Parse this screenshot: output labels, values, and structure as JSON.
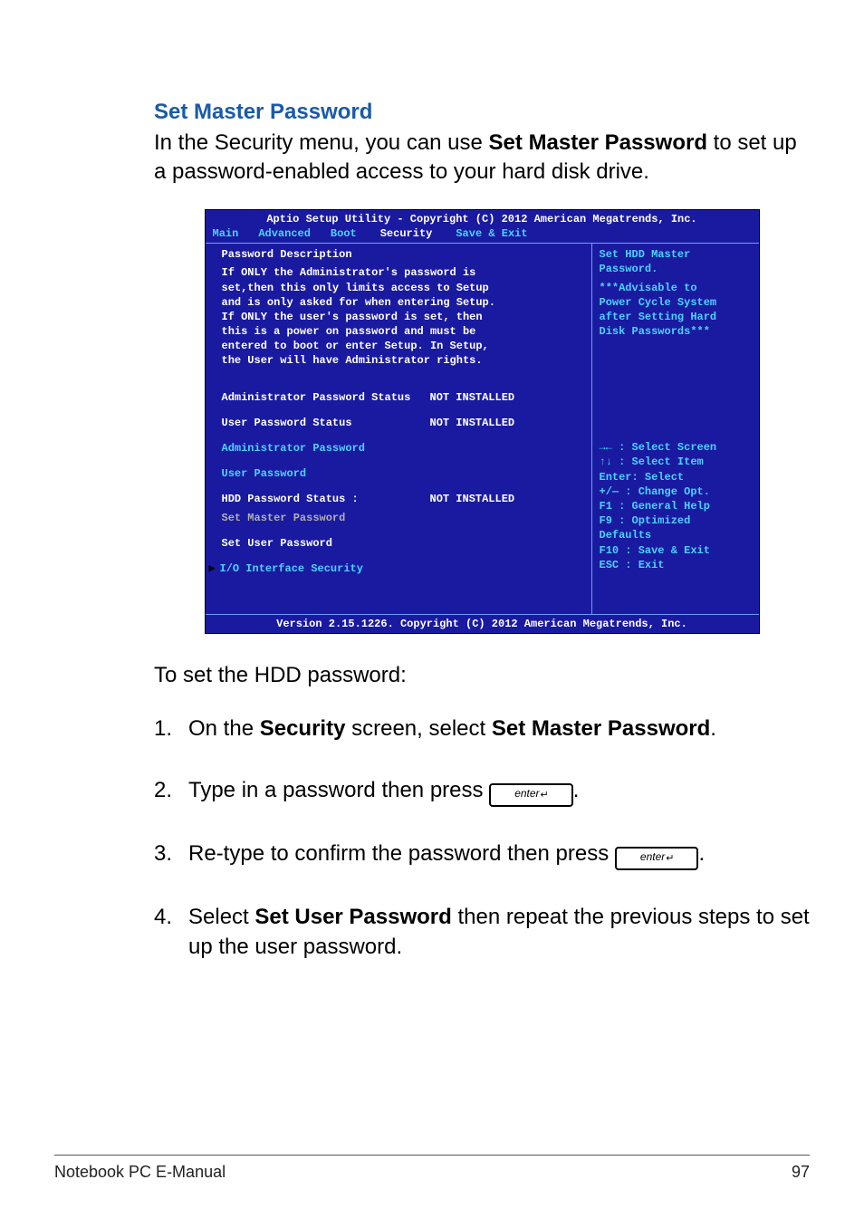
{
  "heading": "Set Master Password",
  "intro_before": "In the Security menu, you can use ",
  "intro_bold": "Set Master Password",
  "intro_after": " to set up a password-enabled access to your hard disk drive.",
  "bios": {
    "title": "Aptio Setup Utility - Copyright (C) 2012 American Megatrends, Inc.",
    "tabs": {
      "main": "Main",
      "advanced": "Advanced",
      "boot": "Boot",
      "security": "Security",
      "save_exit": "Save & Exit"
    },
    "left": {
      "pd_head": "Password Description",
      "desc1": "If ONLY the Administrator's password is",
      "desc2": "set,then this only limits access to Setup",
      "desc3": "and is only asked for when entering Setup.",
      "desc4": "If ONLY the user's password is set, then",
      "desc5": "this is a power on password and must be",
      "desc6": "entered to boot or enter Setup. In Setup,",
      "desc7": "the User will have Administrator rights.",
      "admin_status_lbl": "Administrator Password Status",
      "admin_status_val": "NOT INSTALLED",
      "user_status_lbl": "User Password Status",
      "user_status_val": "NOT INSTALLED",
      "admin_pw": "Administrator Password",
      "user_pw": "User Password",
      "hdd_status_lbl": "HDD Password Status :",
      "hdd_status_val": "NOT INSTALLED",
      "set_master": "Set Master Password",
      "set_user": "Set User Password",
      "io_sec": "I/O Interface Security"
    },
    "right": {
      "h1": "Set HDD Master",
      "h2": "Password.",
      "h3": "***Advisable to",
      "h4": "Power Cycle System",
      "h5": "after Setting Hard",
      "h6": "Disk Passwords***",
      "k1": "→←  : Select Screen",
      "k2": "↑↓  : Select Item",
      "k3": "Enter: Select",
      "k4": "+/—  : Change Opt.",
      "k5": "F1   : General Help",
      "k6": "F9   : Optimized",
      "k7": "Defaults",
      "k8": "F10  : Save & Exit",
      "k9": "ESC  : Exit"
    },
    "footer": "Version 2.15.1226. Copyright (C) 2012 American Megatrends, Inc."
  },
  "after_bios": "To set the HDD password:",
  "steps": {
    "s1_num": "1.",
    "s1_a": "On the ",
    "s1_b": "Security",
    "s1_c": " screen, select ",
    "s1_d": "Set Master Password",
    "s1_e": ".",
    "s2_num": "2.",
    "s2_a": "Type in a password then press ",
    "s2_end": ".",
    "s3_num": "3.",
    "s3_a": "Re-type to confirm the password then press ",
    "s3_end": ".",
    "s4_num": "4.",
    "s4_a": "Select ",
    "s4_b": "Set User Password",
    "s4_c": " then repeat the previous steps to set up the user password."
  },
  "key_label": "enter",
  "footer_left": "Notebook PC E-Manual",
  "footer_right": "97"
}
